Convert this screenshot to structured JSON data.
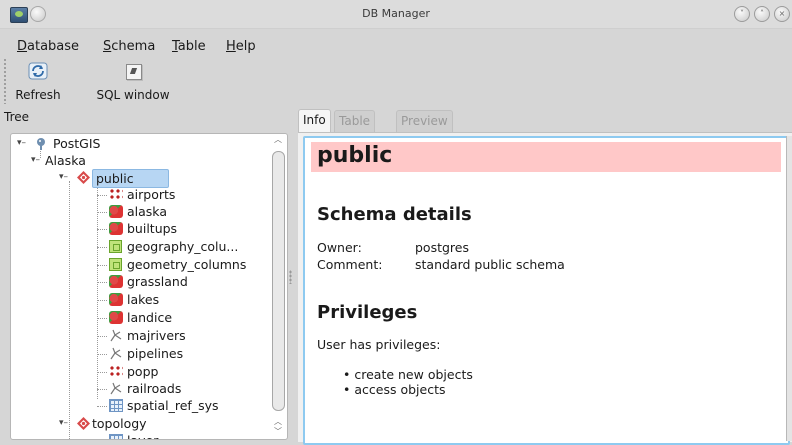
{
  "window": {
    "title": "DB Manager"
  },
  "menubar": {
    "items": [
      {
        "label": "Database",
        "u": "D",
        "rest": "atabase"
      },
      {
        "label": "Schema",
        "u": "S",
        "rest": "chema"
      },
      {
        "label": "Table",
        "u": "T",
        "rest": "able"
      },
      {
        "label": "Help",
        "u": "H",
        "rest": "elp"
      }
    ]
  },
  "toolbar": {
    "refresh_label": "Refresh",
    "sql_label": "SQL window"
  },
  "tree": {
    "label": "Tree",
    "nodes": {
      "postgis": "PostGIS",
      "alaska": "Alaska",
      "public": "public",
      "airports": "airports",
      "alaska_t": "alaska",
      "builtups": "builtups",
      "geography_columns": "geography_colu...",
      "geometry_columns": "geometry_columns",
      "grassland": "grassland",
      "lakes": "lakes",
      "landice": "landice",
      "majrivers": "majrivers",
      "pipelines": "pipelines",
      "popp": "popp",
      "railroads": "railroads",
      "spatial_ref_sys": "spatial_ref_sys",
      "topology": "topology",
      "layer": "layer"
    }
  },
  "tabs": {
    "info": "Info",
    "table": "Table",
    "preview": "Preview"
  },
  "info": {
    "title": "public",
    "schema_heading": "Schema details",
    "owner_label": "Owner:",
    "owner_value": "postgres",
    "comment_label": "Comment:",
    "comment_value": "standard public schema",
    "privileges_heading": "Privileges",
    "privileges_intro": "User has privileges:",
    "privileges": [
      "create new objects",
      "access objects"
    ]
  },
  "colors": {
    "selection": "#b7d6f3",
    "title_band": "#ffc8c8",
    "focus_border": "#8ecaf0"
  }
}
